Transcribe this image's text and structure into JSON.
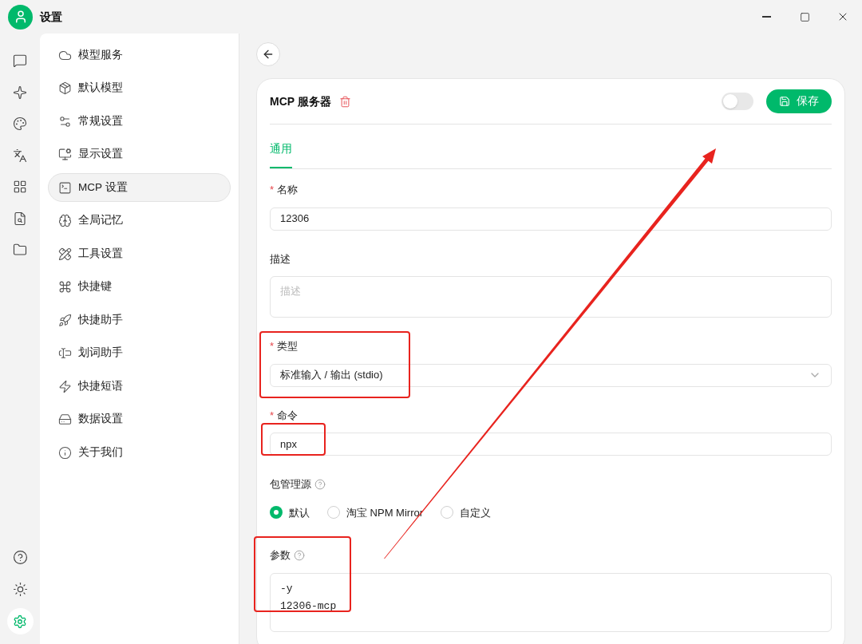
{
  "window": {
    "title": "设置"
  },
  "sidebar": {
    "items": [
      {
        "kind": "cloud",
        "label": "模型服务",
        "selected": false
      },
      {
        "kind": "package",
        "label": "默认模型",
        "selected": false
      },
      {
        "kind": "sliders",
        "label": "常规设置",
        "selected": false
      },
      {
        "kind": "monitor",
        "label": "显示设置",
        "selected": false
      },
      {
        "kind": "terminal",
        "label": "MCP 设置",
        "selected": true
      },
      {
        "kind": "brain",
        "label": "全局记忆",
        "selected": false
      },
      {
        "kind": "tools",
        "label": "工具设置",
        "selected": false
      },
      {
        "kind": "command",
        "label": "快捷键",
        "selected": false
      },
      {
        "kind": "rocket",
        "label": "快捷助手",
        "selected": false
      },
      {
        "kind": "cursor",
        "label": "划词助手",
        "selected": false
      },
      {
        "kind": "zap",
        "label": "快捷短语",
        "selected": false
      },
      {
        "kind": "drive",
        "label": "数据设置",
        "selected": false
      },
      {
        "kind": "info",
        "label": "关于我们",
        "selected": false
      }
    ]
  },
  "server": {
    "title": "MCP 服务器",
    "enabled": false,
    "save_button": "保存",
    "tabs": [
      {
        "label": "通用",
        "selected": true
      }
    ],
    "fields": [
      {
        "kind": "input",
        "required_mark": "*",
        "label": "名称",
        "value": "12306"
      },
      {
        "kind": "textarea",
        "label": "描述",
        "placeholder": "描述"
      },
      {
        "kind": "select",
        "required_mark": "*",
        "label": "类型",
        "value": "标准输入 / 输出 (stdio)"
      },
      {
        "kind": "input",
        "required_mark": "*",
        "label": "命令",
        "value": "npx"
      },
      {
        "kind": "radio",
        "label": "包管理源",
        "help": true,
        "options": [
          {
            "label": "默认",
            "selected": true
          },
          {
            "label": "淘宝 NPM Mirror",
            "selected": false
          },
          {
            "label": "自定义",
            "selected": false
          }
        ]
      },
      {
        "kind": "code",
        "label": "参数",
        "help": true,
        "lines": [
          "-y",
          "12306-mcp"
        ]
      }
    ]
  }
}
